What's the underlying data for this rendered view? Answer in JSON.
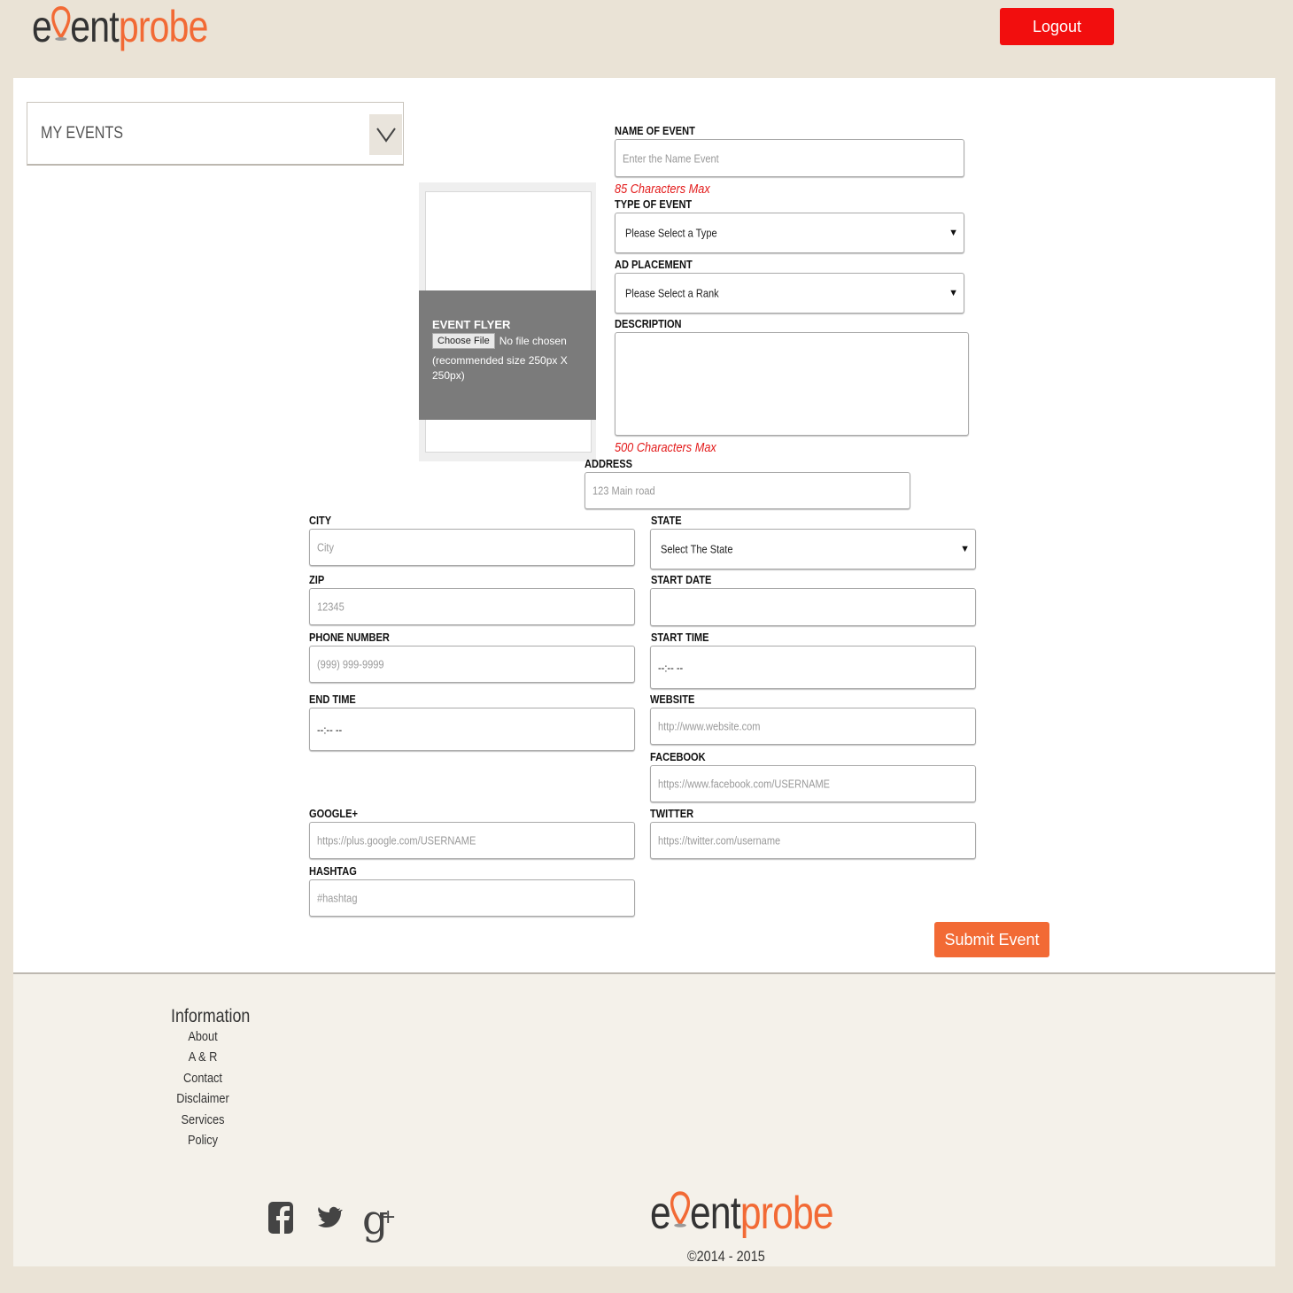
{
  "header": {
    "logo": {
      "e": "e",
      "ent": "ent",
      "probe": "probe"
    },
    "logout_label": "Logout"
  },
  "sidebar": {
    "my_events_label": "MY EVENTS"
  },
  "flyer": {
    "title": "EVENT FLYER",
    "choose_label": "Choose File",
    "file_status": "No file chosen",
    "recommendation": "(recommended size 250px X 250px)"
  },
  "form": {
    "name": {
      "label": "NAME OF EVENT",
      "placeholder": "Enter the Name Event",
      "hint": "85 Characters Max"
    },
    "type": {
      "label": "TYPE OF EVENT",
      "value": "Please Select a Type"
    },
    "ad_placement": {
      "label": "AD PLACEMENT",
      "value": "Please Select a Rank"
    },
    "description": {
      "label": "DESCRIPTION",
      "hint": "500 Characters Max"
    },
    "address": {
      "label": "ADDRESS",
      "placeholder": "123 Main road"
    },
    "city": {
      "label": "CITY",
      "placeholder": "City"
    },
    "state": {
      "label": "STATE",
      "value": "Select The State"
    },
    "zip": {
      "label": "ZIP",
      "placeholder": "12345"
    },
    "start_date": {
      "label": "START DATE",
      "value": ""
    },
    "phone": {
      "label": "PHONE NUMBER",
      "placeholder": "(999) 999-9999"
    },
    "start_time": {
      "label": "START TIME",
      "value": "--:-- --"
    },
    "end_time": {
      "label": "END TIME",
      "value": "--:-- --"
    },
    "website": {
      "label": "WEBSITE",
      "placeholder": "http://www.website.com"
    },
    "facebook": {
      "label": "FACEBOOK",
      "placeholder": "https://www.facebook.com/USERNAME"
    },
    "google": {
      "label": "GOOGLE+",
      "placeholder": "https://plus.google.com/USERNAME"
    },
    "twitter": {
      "label": "TWITTER",
      "placeholder": "https://twitter.com/username"
    },
    "hashtag": {
      "label": "HASHTAG",
      "placeholder": "#hashtag"
    },
    "submit_label": "Submit Event"
  },
  "footer": {
    "info_title": "Information",
    "links": [
      "About",
      "A & R",
      "Contact",
      "Disclaimer",
      "Services",
      "Policy"
    ],
    "social_icons": [
      "facebook-icon",
      "twitter-icon",
      "google-plus-icon"
    ],
    "copyright": "©2014 - 2015"
  },
  "colors": {
    "brand_orange": "#f26a35",
    "logout_red": "#f20e0e",
    "hint_red": "#e31b1b",
    "background": "#eae3d6"
  }
}
